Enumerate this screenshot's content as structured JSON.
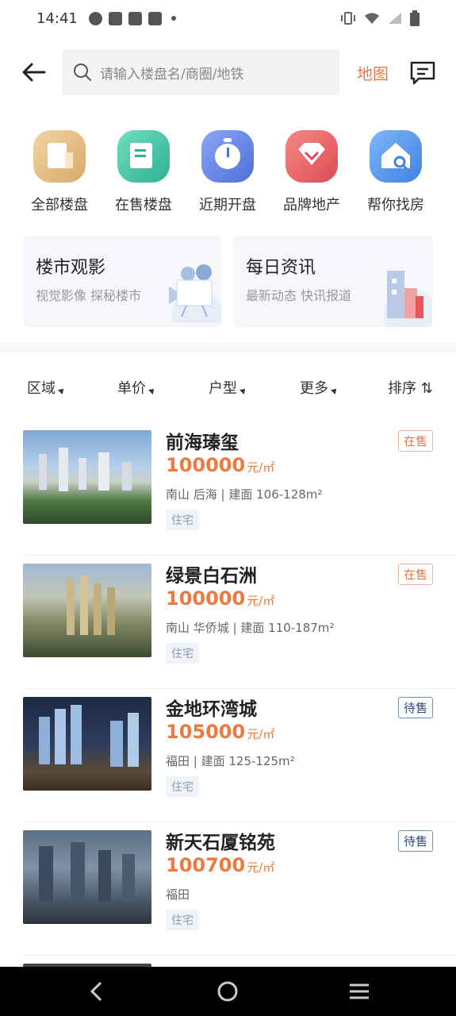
{
  "status_bar": {
    "time": "14:41",
    "icons_left": [
      "gauge-icon",
      "bag-icon",
      "bag-icon",
      "bag-icon",
      "dot-icon"
    ],
    "icons_right": [
      "vibrate-icon",
      "wifi-icon",
      "signal-icon",
      "battery-icon"
    ]
  },
  "header": {
    "back_icon": "arrow-left-icon",
    "search_placeholder": "请输入楼盘名/商圈/地铁",
    "map_label": "地图",
    "message_icon": "message-icon"
  },
  "categories": [
    {
      "label": "全部楼盘",
      "icon": "building-icon",
      "color": "#d9a96a"
    },
    {
      "label": "在售楼盘",
      "icon": "onsale-building-icon",
      "color": "#3fc0a0"
    },
    {
      "label": "近期开盘",
      "icon": "clock-icon",
      "color": "#5b7fe0"
    },
    {
      "label": "品牌地产",
      "icon": "diamond-icon",
      "color": "#e8575b"
    },
    {
      "label": "帮你找房",
      "icon": "house-search-icon",
      "color": "#4f8fe8"
    }
  ],
  "banners": [
    {
      "title": "楼市观影",
      "subtitle": "视觉影像 探秘楼市",
      "icon": "camera-icon"
    },
    {
      "title": "每日资讯",
      "subtitle": "最新动态 快讯报道",
      "icon": "buildings-icon"
    }
  ],
  "filters": [
    {
      "label": "区域"
    },
    {
      "label": "单价"
    },
    {
      "label": "户型"
    },
    {
      "label": "更多"
    },
    {
      "label": "排序 ⇅"
    }
  ],
  "listings": [
    {
      "name": "前海瑧玺",
      "status": "在售",
      "status_type": "onsale",
      "price": "100000",
      "unit": "元/㎡",
      "meta": "南山  后海 | 建面  106-128m²",
      "tag": "住宅"
    },
    {
      "name": "绿景白石洲",
      "status": "在售",
      "status_type": "onsale",
      "price": "100000",
      "unit": "元/㎡",
      "meta": "南山  华侨城 | 建面  110-187m²",
      "tag": "住宅"
    },
    {
      "name": "金地环湾城",
      "status": "待售",
      "status_type": "pending",
      "price": "105000",
      "unit": "元/㎡",
      "meta": "福田 | 建面  125-125m²",
      "tag": "住宅"
    },
    {
      "name": "新天石厦铭苑",
      "status": "待售",
      "status_type": "pending",
      "price": "100700",
      "unit": "元/㎡",
      "meta": "福田",
      "tag": "住宅"
    }
  ],
  "navbar": {
    "back_icon": "nav-back-icon",
    "home_icon": "nav-home-icon",
    "menu_icon": "nav-menu-icon"
  }
}
